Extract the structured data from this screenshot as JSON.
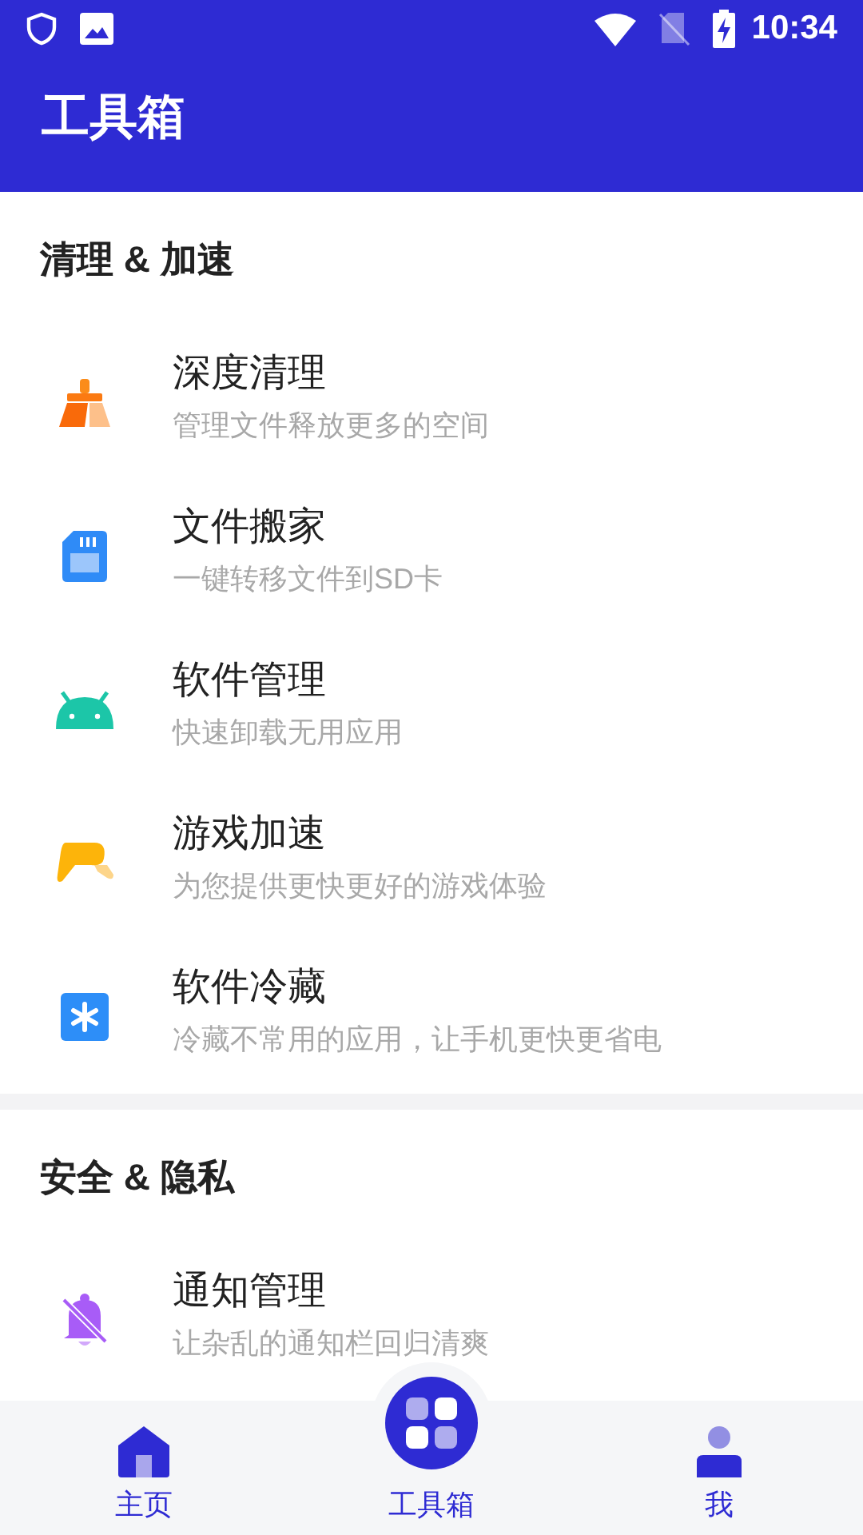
{
  "status_bar": {
    "time": "10:34"
  },
  "app_bar": {
    "title": "工具箱"
  },
  "sections": [
    {
      "title": "清理 & 加速",
      "items": [
        {
          "kind": "broom",
          "title": "深度清理",
          "subtitle": "管理文件释放更多的空间"
        },
        {
          "kind": "sdcard",
          "title": "文件搬家",
          "subtitle": "一键转移文件到SD卡"
        },
        {
          "kind": "android",
          "title": "软件管理",
          "subtitle": "快速卸载无用应用"
        },
        {
          "kind": "gamepad",
          "title": "游戏加速",
          "subtitle": "为您提供更快更好的游戏体验"
        },
        {
          "kind": "freeze",
          "title": "软件冷藏",
          "subtitle": "冷藏不常用的应用，让手机更快更省电"
        }
      ]
    },
    {
      "title": "安全 & 隐私",
      "items": [
        {
          "kind": "bell",
          "title": "通知管理",
          "subtitle": "让杂乱的通知栏回归清爽"
        }
      ]
    }
  ],
  "bottom_nav": [
    {
      "kind": "home",
      "label": "主页"
    },
    {
      "kind": "center",
      "label": "工具箱"
    },
    {
      "kind": "profile",
      "label": "我"
    }
  ]
}
